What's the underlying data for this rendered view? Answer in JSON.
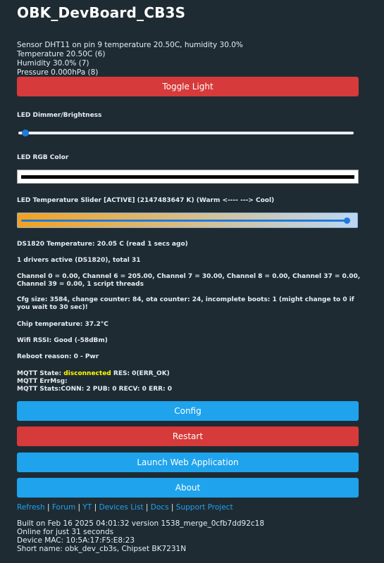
{
  "title": "OBK_DevBoard_CB3S",
  "sensor": {
    "line1": "Sensor DHT11 on pin 9 temperature 20.50C, humidity 30.0%",
    "line2": "Temperature 20.50C (6)",
    "line3": "Humidity 30.0% (7)",
    "line4": "Pressure 0.000hPa (8)"
  },
  "buttons": {
    "toggle": "Toggle Light",
    "config": "Config",
    "restart": "Restart",
    "launch": "Launch Web Application",
    "about": "About"
  },
  "dimmer": {
    "label": "LED Dimmer/Brightness",
    "value": 0.01
  },
  "rgb": {
    "label": "LED RGB Color",
    "value": "#000000"
  },
  "temperature_slider": {
    "label": "LED Temperature Slider [ACTIVE] (2147483647 K) (Warm <---- ---> Cool)",
    "value": 1.0
  },
  "info": {
    "ds1820": "DS1820 Temperature: 20.05 C (read 1 secs ago)",
    "drivers": "1 drivers active (DS1820), total 31",
    "channels": "Channel 0 = 0.00, Channel 6 = 205.00, Channel 7 = 30.00, Channel 8 = 0.00, Channel 37 = 0.00, Channel 39 = 0.00, 1 script threads",
    "cfg": "Cfg size: 3584, change counter: 84, ota counter: 24, incomplete boots: 1 (might change to 0 if you wait to 30 sec)!",
    "chip_temp": "Chip temperature: 37.2°C",
    "wifi": "Wifi RSSI: Good (-58dBm)",
    "reboot": "Reboot reason: 0 - Pwr",
    "mqtt_state_prefix": "MQTT State: ",
    "mqtt_state": "disconnected",
    "mqtt_state_suffix": " RES: 0(ERR_OK)",
    "mqtt_errmsg": "MQTT ErrMsg:",
    "mqtt_stats": "MQTT Stats:CONN: 2 PUB: 0 RECV: 0 ERR: 0"
  },
  "links": {
    "refresh": "Refresh",
    "forum": "Forum",
    "yt": "YT",
    "devices": "Devices List",
    "docs": "Docs",
    "support": "Support Project",
    "separator": "|"
  },
  "footer": {
    "built": "Built on Feb 16 2025 04:01:32 version 1538_merge_0cfb7dd92c18",
    "online": "Online for just 31 seconds",
    "mac": "Device MAC: 10:5A:17:F5:E8:23",
    "short": "Short name: obk_dev_cb3s, Chipset BK7231N"
  },
  "colors": {
    "background": "#1f2b33",
    "red": "#d63a3a",
    "blue": "#1fa3ec",
    "warning": "#ffff00"
  }
}
